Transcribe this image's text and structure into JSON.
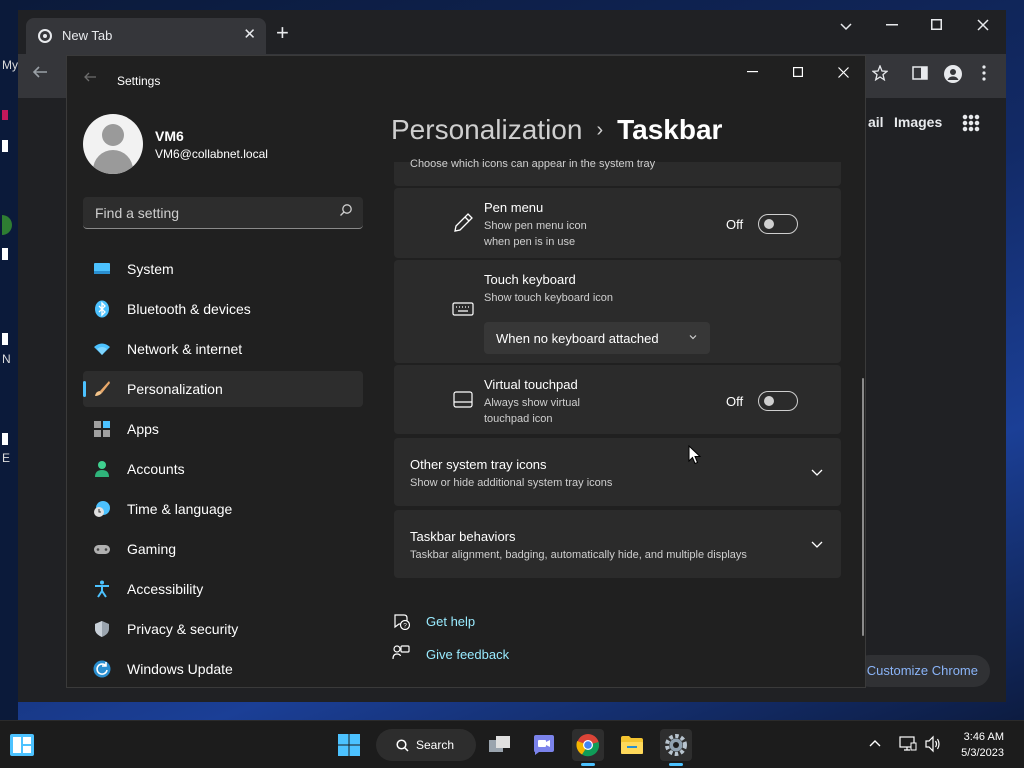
{
  "desktop": {
    "fragments": [
      "My",
      "N",
      "E"
    ]
  },
  "chrome": {
    "tab_title": "New Tab",
    "tab_close": "✕",
    "new_tab": "+",
    "links": [
      "ail",
      "Images"
    ],
    "customize_label": "Customize Chrome"
  },
  "settings": {
    "app_title": "Settings",
    "user": {
      "name": "VM6",
      "email": "VM6@collabnet.local"
    },
    "search_placeholder": "Find a setting",
    "nav": [
      {
        "label": "System",
        "icon": "monitor-icon"
      },
      {
        "label": "Bluetooth & devices",
        "icon": "bluetooth-icon"
      },
      {
        "label": "Network & internet",
        "icon": "wifi-icon"
      },
      {
        "label": "Personalization",
        "icon": "paintbrush-icon",
        "active": true
      },
      {
        "label": "Apps",
        "icon": "apps-icon"
      },
      {
        "label": "Accounts",
        "icon": "person-icon"
      },
      {
        "label": "Time & language",
        "icon": "clock-globe-icon"
      },
      {
        "label": "Gaming",
        "icon": "gamepad-icon"
      },
      {
        "label": "Accessibility",
        "icon": "accessibility-icon"
      },
      {
        "label": "Privacy & security",
        "icon": "shield-icon"
      },
      {
        "label": "Windows Update",
        "icon": "update-icon"
      }
    ],
    "breadcrumb": {
      "parent": "Personalization",
      "current": "Taskbar",
      "separator": "›"
    },
    "partial_header_text": "Choose which icons can appear in the system tray",
    "pen_menu": {
      "title": "Pen menu",
      "desc_line1": "Show pen menu icon",
      "desc_line2": "when pen is in use",
      "state_label": "Off",
      "on": false
    },
    "touch_keyboard": {
      "title": "Touch keyboard",
      "desc": "Show touch keyboard icon",
      "dropdown_value": "When no keyboard attached"
    },
    "virtual_touchpad": {
      "title": "Virtual touchpad",
      "desc_line1": "Always show virtual",
      "desc_line2": "touchpad icon",
      "state_label": "Off",
      "on": false
    },
    "other_tray": {
      "title": "Other system tray icons",
      "desc": "Show or hide additional system tray icons"
    },
    "behaviors": {
      "title": "Taskbar behaviors",
      "desc": "Taskbar alignment, badging, automatically hide, and multiple displays"
    },
    "help": {
      "get_help": "Get help",
      "give_feedback": "Give feedback"
    }
  },
  "taskbar": {
    "search_label": "Search",
    "clock": {
      "time": "3:46 AM",
      "date": "5/3/2023"
    }
  },
  "colors": {
    "accent": "#4cc2ff",
    "link": "#99ebff",
    "bg": "#202020",
    "card": "#2b2b2b"
  }
}
